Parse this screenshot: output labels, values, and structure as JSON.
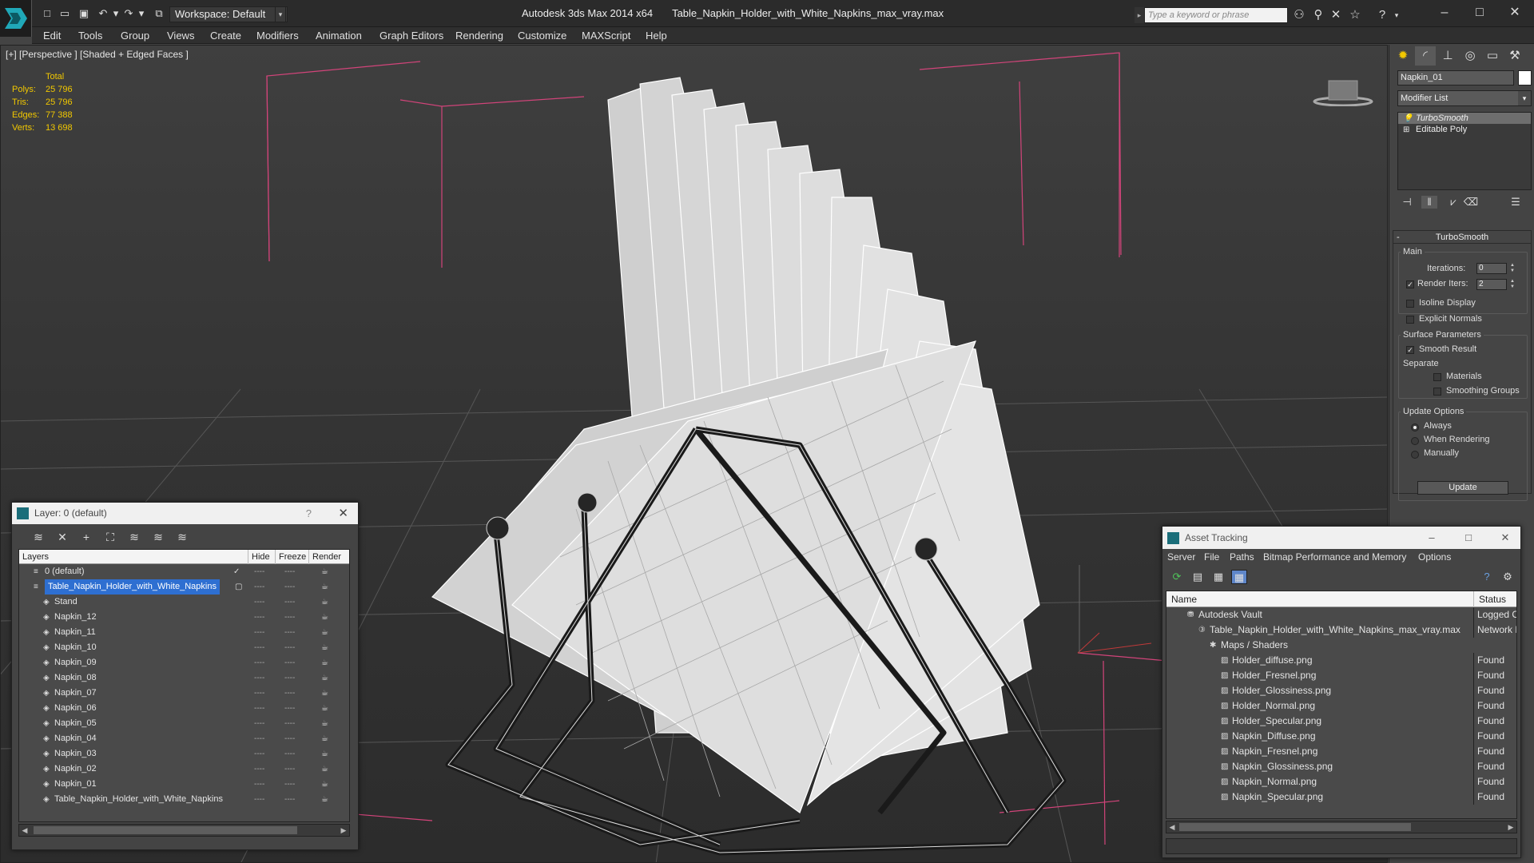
{
  "titlebar": {
    "workspace": "Workspace: Default",
    "app_name": "Autodesk 3ds Max  2014 x64",
    "file_name": "Table_Napkin_Holder_with_White_Napkins_max_vray.max",
    "search_placeholder": "Type a keyword or phrase"
  },
  "menu": [
    "Edit",
    "Tools",
    "Group",
    "Views",
    "Create",
    "Modifiers",
    "Animation",
    "Graph Editors",
    "Rendering",
    "Customize",
    "MAXScript",
    "Help"
  ],
  "viewport": {
    "label": "[+] [Perspective ] [Shaded + Edged Faces ]",
    "stats": {
      "header": "Total",
      "rows": [
        {
          "k": "Polys:",
          "v": "25 796"
        },
        {
          "k": "Tris:",
          "v": "25 796"
        },
        {
          "k": "Edges:",
          "v": "77 388"
        },
        {
          "k": "Verts:",
          "v": "13 698"
        }
      ]
    }
  },
  "command_panel": {
    "object_name": "Napkin_01",
    "modifier_list": "Modifier List",
    "stack": [
      "TurboSmooth",
      "Editable Poly"
    ],
    "rollout_title": "TurboSmooth",
    "main_group": "Main",
    "iterations_label": "Iterations:",
    "iterations_value": "0",
    "render_iters_label": "Render Iters:",
    "render_iters_value": "2",
    "isoline": "Isoline Display",
    "explicit": "Explicit Normals",
    "surface_group": "Surface Parameters",
    "smooth_result": "Smooth Result",
    "separate": "Separate",
    "materials": "Materials",
    "smoothing_groups": "Smoothing Groups",
    "update_group": "Update Options",
    "always": "Always",
    "when_rendering": "When Rendering",
    "manually": "Manually",
    "update_button": "Update"
  },
  "layer_window": {
    "title": "Layer: 0 (default)",
    "columns": [
      "Layers",
      "Hide",
      "Freeze",
      "Render"
    ],
    "rows": [
      {
        "name": "0 (default)",
        "level": 1,
        "selected": false
      },
      {
        "name": "Table_Napkin_Holder_with_White_Napkins",
        "level": 1,
        "selected": true
      },
      {
        "name": "Stand",
        "level": 2,
        "selected": false
      },
      {
        "name": "Napkin_12",
        "level": 2,
        "selected": false
      },
      {
        "name": "Napkin_11",
        "level": 2,
        "selected": false
      },
      {
        "name": "Napkin_10",
        "level": 2,
        "selected": false
      },
      {
        "name": "Napkin_09",
        "level": 2,
        "selected": false
      },
      {
        "name": "Napkin_08",
        "level": 2,
        "selected": false
      },
      {
        "name": "Napkin_07",
        "level": 2,
        "selected": false
      },
      {
        "name": "Napkin_06",
        "level": 2,
        "selected": false
      },
      {
        "name": "Napkin_05",
        "level": 2,
        "selected": false
      },
      {
        "name": "Napkin_04",
        "level": 2,
        "selected": false
      },
      {
        "name": "Napkin_03",
        "level": 2,
        "selected": false
      },
      {
        "name": "Napkin_02",
        "level": 2,
        "selected": false
      },
      {
        "name": "Napkin_01",
        "level": 2,
        "selected": false
      },
      {
        "name": "Table_Napkin_Holder_with_White_Napkins",
        "level": 2,
        "selected": false
      }
    ]
  },
  "asset_window": {
    "title": "Asset Tracking",
    "menu": [
      "Server",
      "File",
      "Paths",
      "Bitmap Performance and Memory",
      "Options"
    ],
    "columns": [
      "Name",
      "Status"
    ],
    "rows": [
      {
        "name": "Autodesk Vault",
        "status": "Logged Out",
        "level": 1
      },
      {
        "name": "Table_Napkin_Holder_with_White_Napkins_max_vray.max",
        "status": "Network Path",
        "level": 2
      },
      {
        "name": "Maps / Shaders",
        "status": "",
        "level": 3
      },
      {
        "name": "Holder_diffuse.png",
        "status": "Found",
        "level": 4
      },
      {
        "name": "Holder_Fresnel.png",
        "status": "Found",
        "level": 4
      },
      {
        "name": "Holder_Glossiness.png",
        "status": "Found",
        "level": 4
      },
      {
        "name": "Holder_Normal.png",
        "status": "Found",
        "level": 4
      },
      {
        "name": "Holder_Specular.png",
        "status": "Found",
        "level": 4
      },
      {
        "name": "Napkin_Diffuse.png",
        "status": "Found",
        "level": 4
      },
      {
        "name": "Napkin_Fresnel.png",
        "status": "Found",
        "level": 4
      },
      {
        "name": "Napkin_Glossiness.png",
        "status": "Found",
        "level": 4
      },
      {
        "name": "Napkin_Normal.png",
        "status": "Found",
        "level": 4
      },
      {
        "name": "Napkin_Specular.png",
        "status": "Found",
        "level": 4
      }
    ]
  }
}
